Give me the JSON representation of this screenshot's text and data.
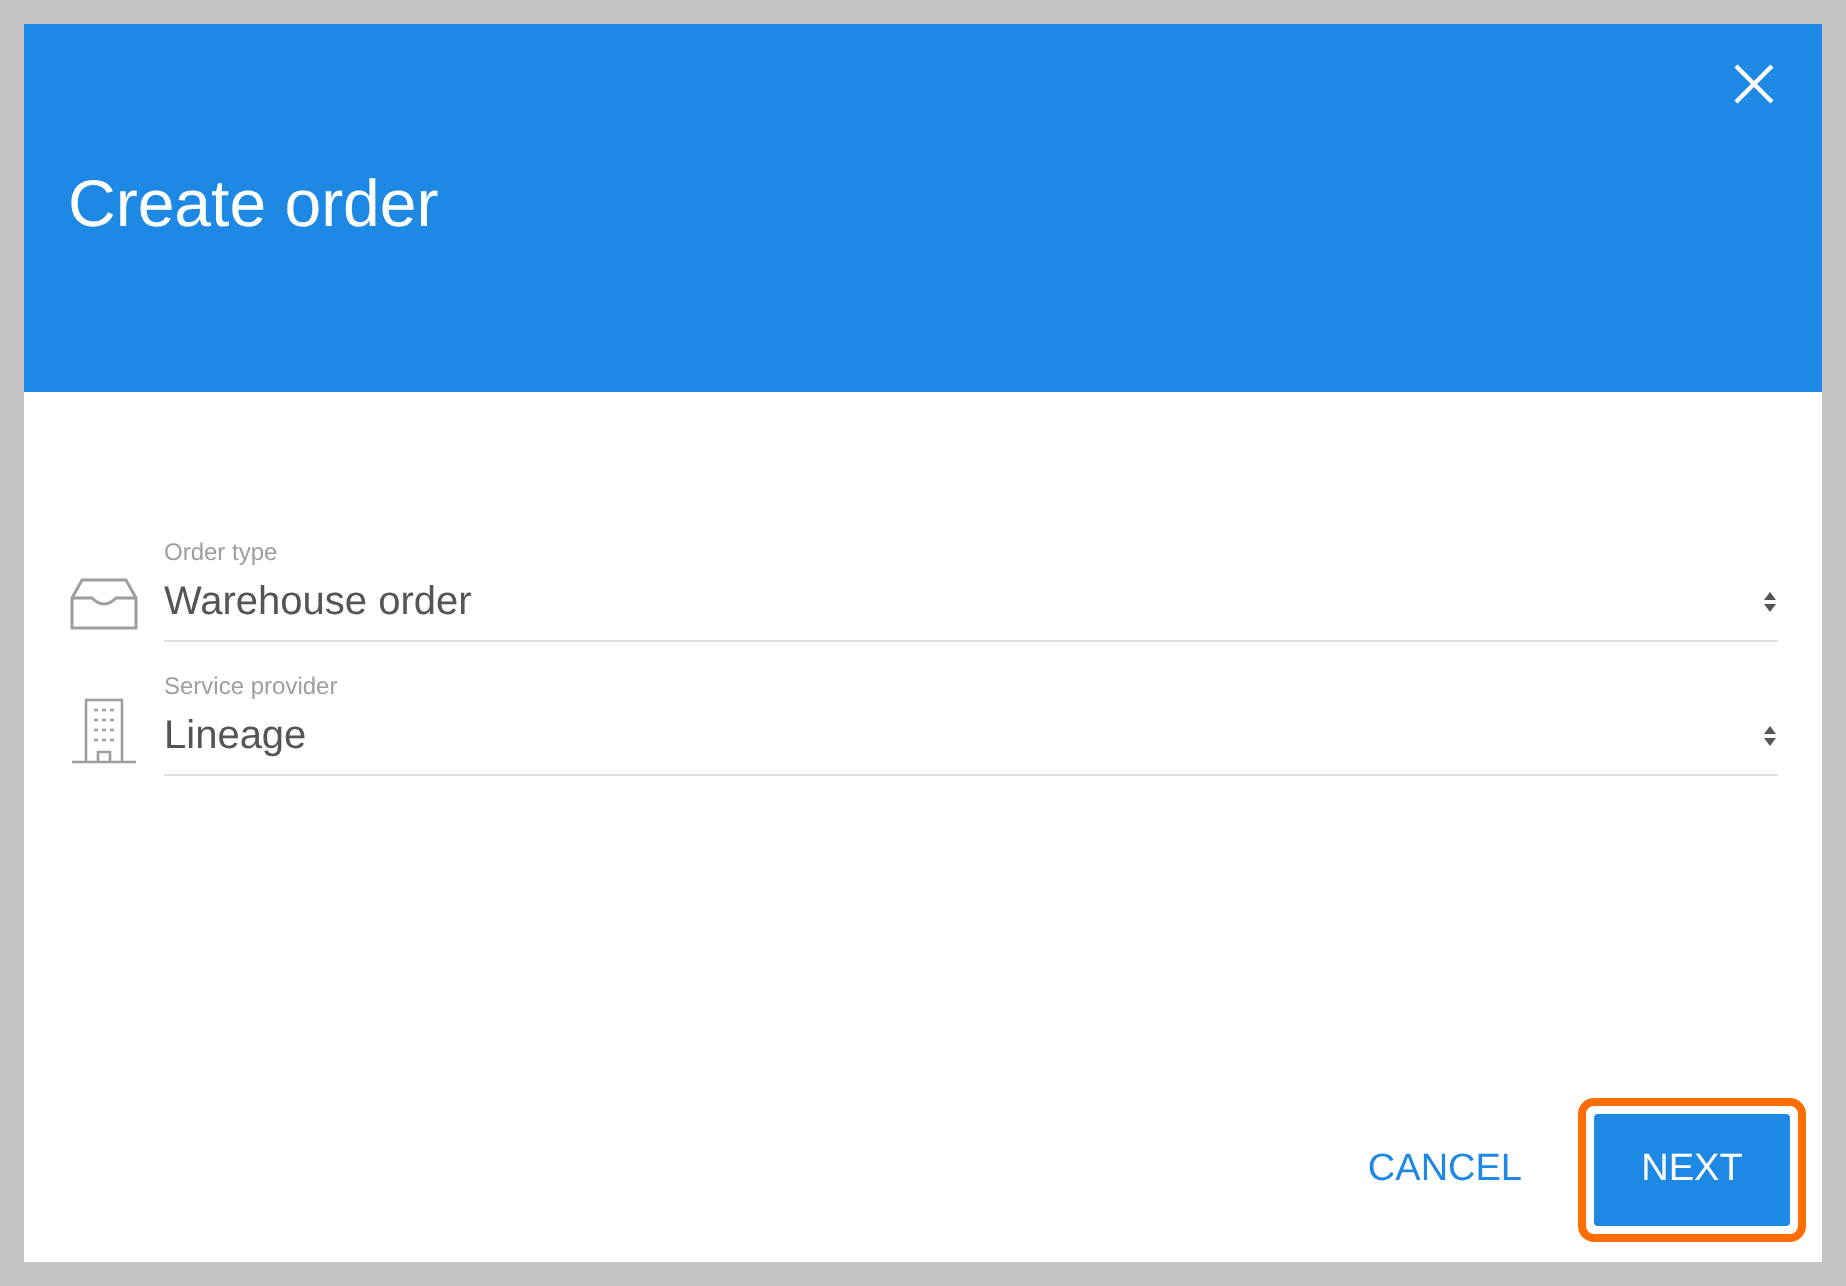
{
  "dialog": {
    "title": "Create order"
  },
  "fields": [
    {
      "kind": "tray",
      "label": "Order type",
      "value": "Warehouse order"
    },
    {
      "kind": "building",
      "label": "Service provider",
      "value": "Lineage"
    }
  ],
  "buttons": [
    {
      "kind": "text",
      "label": "CANCEL",
      "highlighted": false
    },
    {
      "kind": "filled",
      "label": "NEXT",
      "highlighted": true
    }
  ]
}
